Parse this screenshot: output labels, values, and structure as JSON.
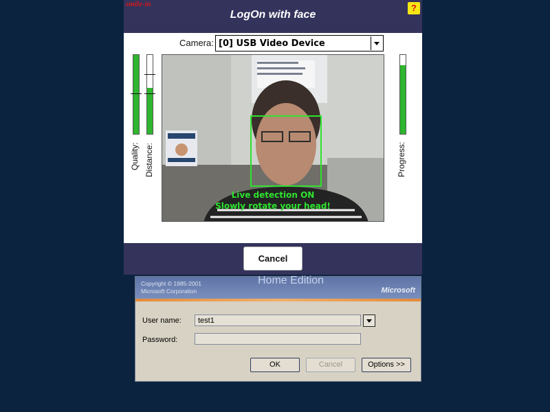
{
  "face_dialog": {
    "brand": "smile-in",
    "title": "LogOn with face",
    "help_icon": "?",
    "camera_label": "Camera:",
    "camera_value": "[0] USB Video Device",
    "quality_label": "Quality:",
    "distance_label": "Distance:",
    "progress_label": "Progress:",
    "quality_level": 1.0,
    "distance_level": 0.58,
    "progress_level": 0.87,
    "overlay_line1": "Live detection ON",
    "overlay_line2": "Slowly rotate your head!",
    "cancel_label": "Cancel",
    "accent_color": "#2fb52f",
    "dialog_color": "#34335c"
  },
  "windows_logon": {
    "copyright": "Copyright © 1985-2001",
    "company": "Microsoft Corporation",
    "edition": "Home Edition",
    "brand": "Microsoft",
    "username_label": "User name:",
    "username_value": "test1",
    "password_label": "Password:",
    "ok_label": "OK",
    "cancel_label": "Cancel",
    "options_label": "Options >>"
  }
}
